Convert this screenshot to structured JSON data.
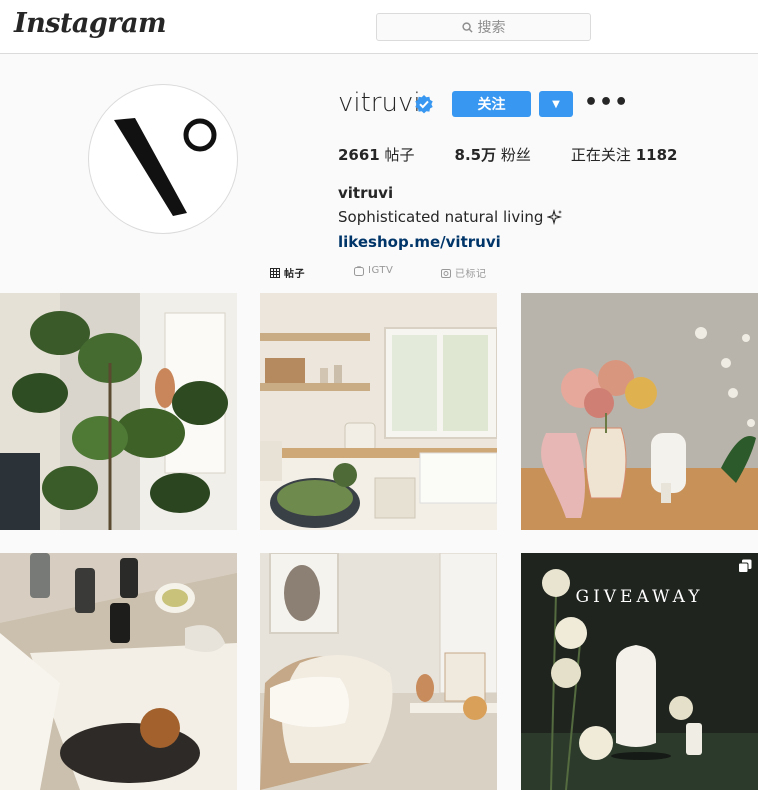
{
  "header": {
    "logo_text": "Instagram",
    "search_placeholder": "搜索"
  },
  "profile": {
    "username": "vitruvi",
    "verified": true,
    "follow_label": "关注",
    "stats": [
      {
        "value": "2661",
        "label": "帖子"
      },
      {
        "value": "8.5万",
        "label": "粉丝"
      },
      {
        "value": "1182",
        "label": "正在关注"
      }
    ],
    "bio_name": "vitruvi",
    "bio_text": "Sophisticated natural living",
    "bio_link": "likeshop.me/vitruvi"
  },
  "tabs": [
    {
      "label": "帖子",
      "icon": "grid-icon",
      "active": true
    },
    {
      "label": "IGTV",
      "icon": "igtv-icon",
      "active": false
    },
    {
      "label": "已标记",
      "icon": "tagged-icon",
      "active": false
    }
  ],
  "posts": [
    {
      "alt": "fiddle leaf fig plant"
    },
    {
      "alt": "kitchen shelves"
    },
    {
      "alt": "flowers in vase with diffuser"
    },
    {
      "alt": "essential oil bottles on book"
    },
    {
      "alt": "cozy chair with knit blanket"
    },
    {
      "alt": "giveaway diffuser",
      "overlay_text": "GIVEAWAY"
    }
  ]
}
